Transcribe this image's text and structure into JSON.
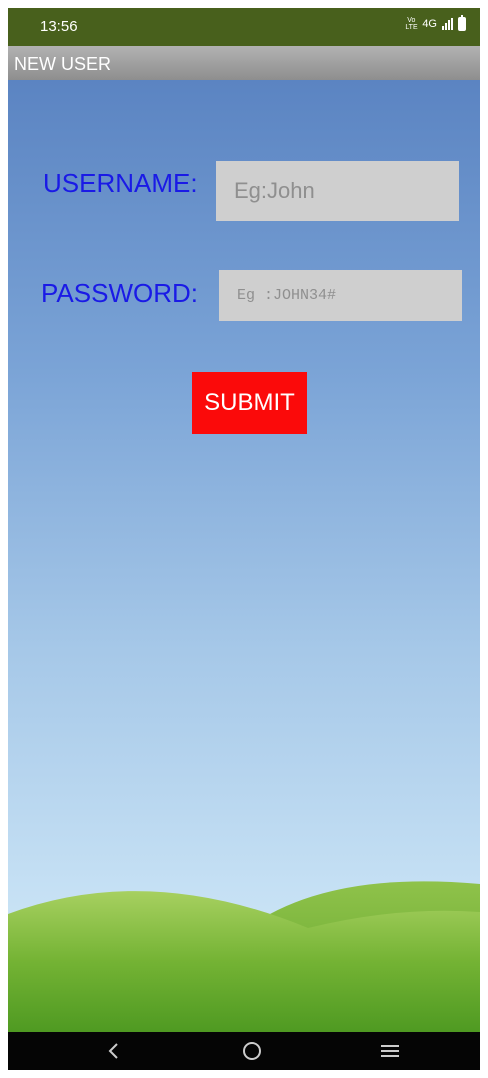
{
  "status_bar": {
    "time": "13:56",
    "volte": "Vo LTE",
    "network": "4G",
    "icons": [
      "volte-icon",
      "signal-icon",
      "battery-icon"
    ]
  },
  "app_bar": {
    "title": "NEW USER"
  },
  "form": {
    "username_label": "USERNAME:",
    "username_placeholder": "Eg:John",
    "username_value": "",
    "password_label": "PASSWORD:",
    "password_placeholder": "Eg :JOHN34#",
    "password_value": "",
    "submit_label": "SUBMIT"
  },
  "nav_bar": {
    "icons": [
      "back-icon",
      "home-icon",
      "recents-icon"
    ]
  },
  "colors": {
    "status_bar": "#48601c",
    "app_bar": "#9e9e9e",
    "label_text": "#1a1ae6",
    "input_bg": "#cfcfcf",
    "submit_bg": "#fb0a0a",
    "sky_top": "#5b84c2",
    "sky_bottom": "#d6ecf7",
    "hill": "#6bb02c",
    "nav_bar": "#050505"
  }
}
